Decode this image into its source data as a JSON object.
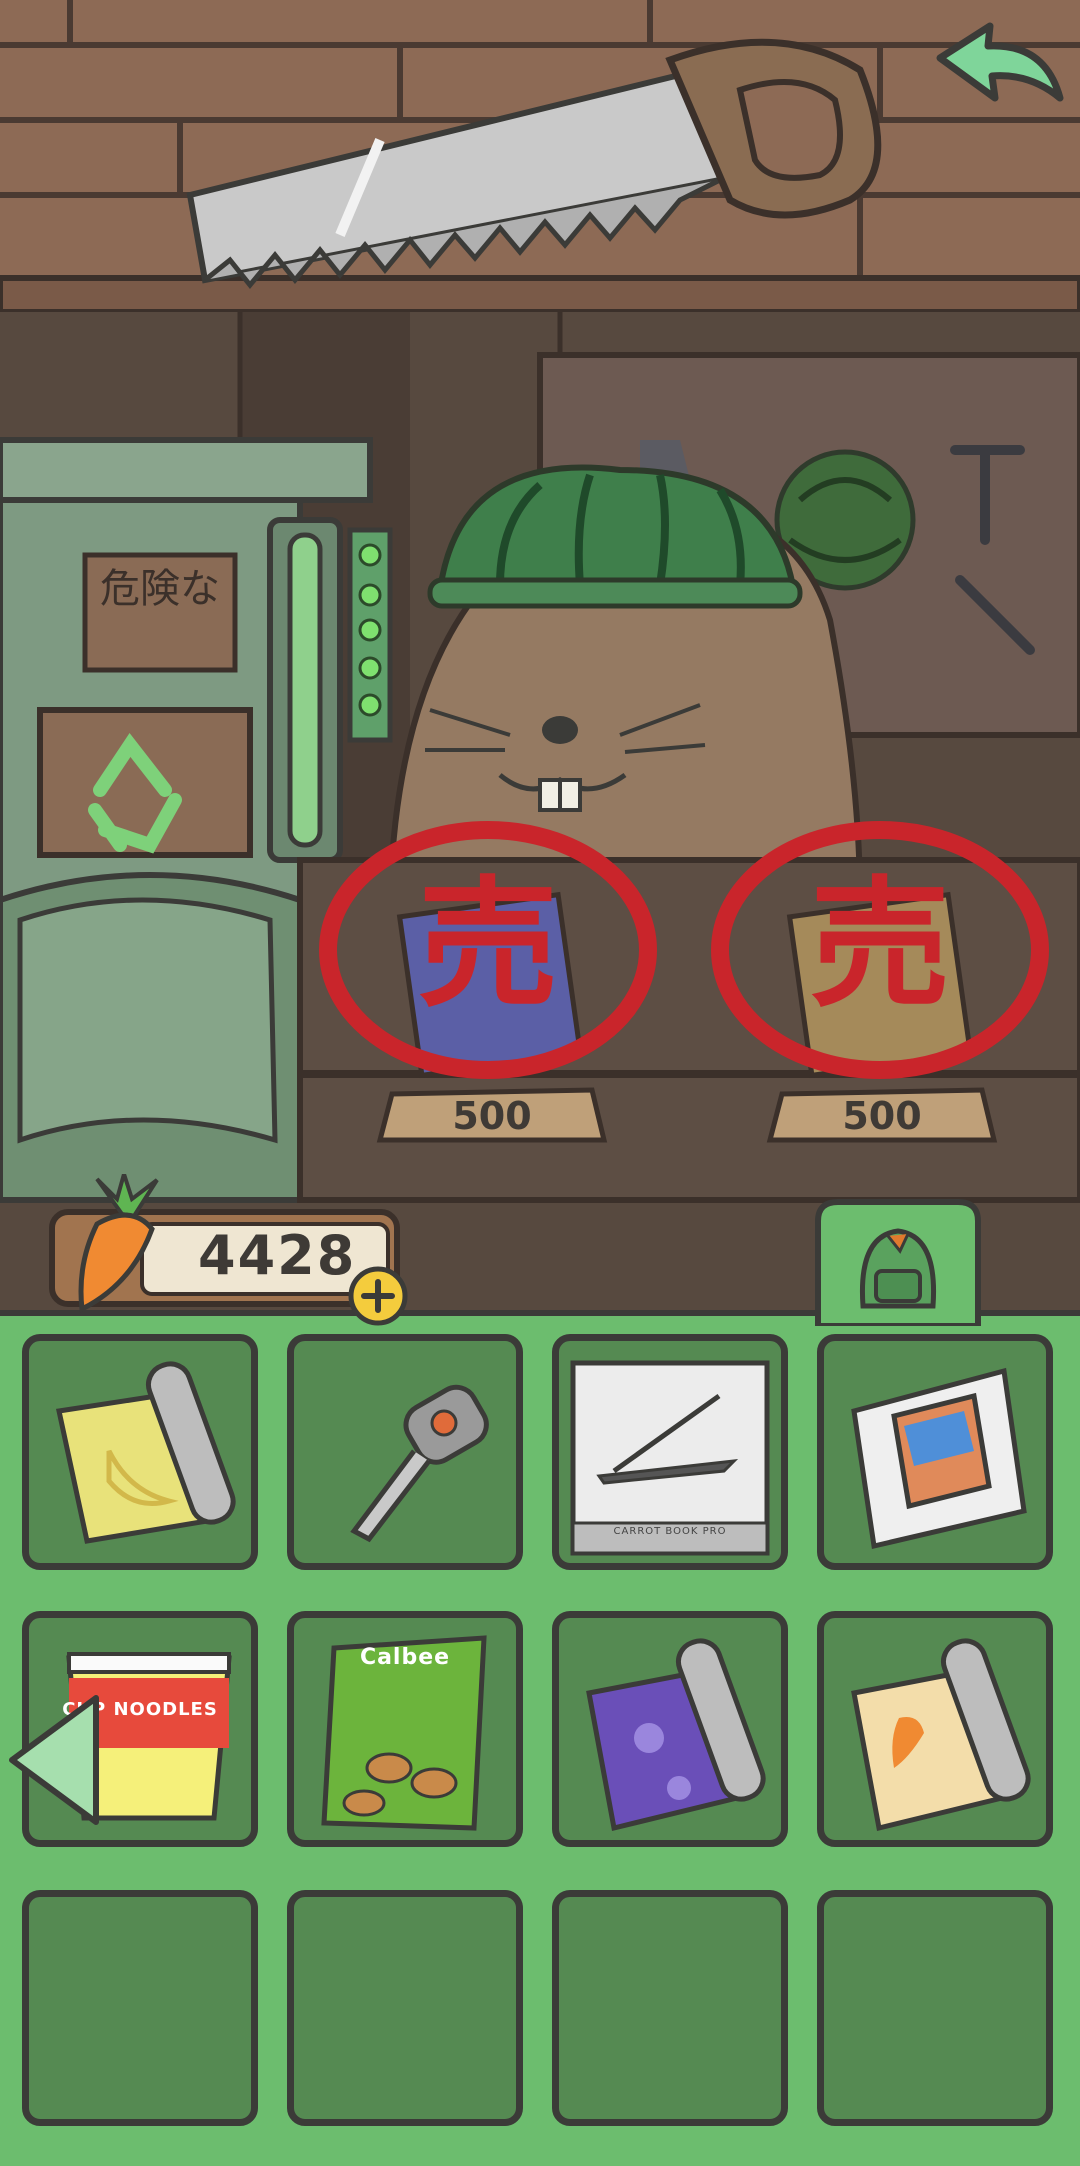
{
  "scene": {
    "warning_sign": "危険な"
  },
  "shop": {
    "sold_mark": "売",
    "items": [
      {
        "price": "500"
      },
      {
        "price": "500"
      }
    ]
  },
  "wallet": {
    "carrots": "4428"
  },
  "inventory": {
    "slots": [
      {
        "icon": "banana-wrapping-paper-icon"
      },
      {
        "icon": "car-key-icon"
      },
      {
        "icon": "laptop-box-icon",
        "label": "CARROT BOOK PRO"
      },
      {
        "icon": "phone-box-icon"
      },
      {
        "icon": "cup-noodles-icon",
        "label": "CUP NOODLES"
      },
      {
        "icon": "snack-bag-icon",
        "label": "Calbee"
      },
      {
        "icon": "sakura-wrapping-paper-icon"
      },
      {
        "icon": "carrot-wrapping-paper-icon"
      },
      {
        "icon": ""
      },
      {
        "icon": ""
      },
      {
        "icon": ""
      },
      {
        "icon": ""
      }
    ]
  },
  "colors": {
    "panel": "#6cbd6e",
    "slot": "#558a52",
    "stamp": "#c9252b",
    "wood": "#8a6550"
  }
}
